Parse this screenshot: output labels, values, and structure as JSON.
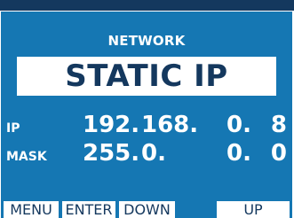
{
  "header": {
    "title": "NETWORK"
  },
  "mode": {
    "label": "STATIC IP"
  },
  "ip": {
    "label": "IP",
    "octets": [
      "192.",
      "168.",
      "0.",
      "8"
    ]
  },
  "mask": {
    "label": "MASK",
    "octets": [
      "255.",
      "0.",
      "0.",
      "0"
    ]
  },
  "softkeys": {
    "menu": "MENU",
    "enter": "ENTER",
    "down": "DOWN",
    "up": "UP"
  },
  "colors": {
    "screen_background": "#1577b3",
    "top_bar": "#14385e",
    "text_light": "#ffffff",
    "text_dark": "#14385e"
  }
}
